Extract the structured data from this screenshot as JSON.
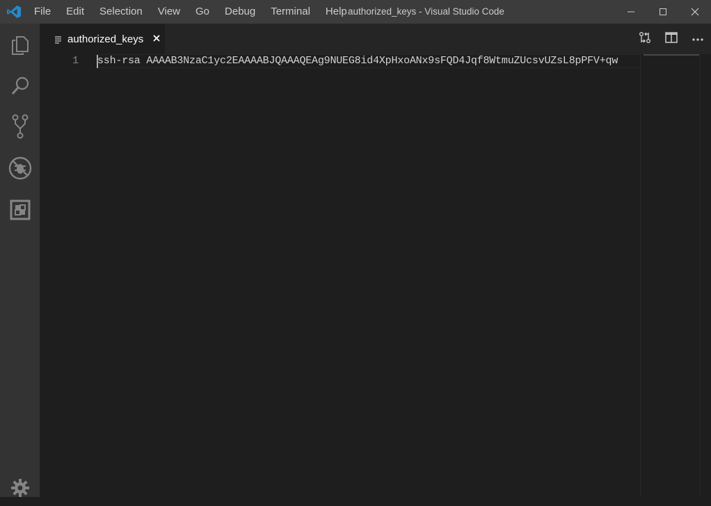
{
  "window": {
    "title": "authorized_keys - Visual Studio Code",
    "logo_icon": "vscode-logo-icon"
  },
  "menubar": {
    "items": [
      "File",
      "Edit",
      "Selection",
      "View",
      "Go",
      "Debug",
      "Terminal",
      "Help"
    ]
  },
  "window_controls": [
    "minimize-icon",
    "maximize-icon",
    "close-icon"
  ],
  "activitybar": {
    "icons": [
      "files-icon",
      "search-icon",
      "source-control-icon",
      "debug-icon",
      "extensions-icon",
      "gear-icon"
    ]
  },
  "tabs": [
    {
      "label": "authorized_keys",
      "icon": "file-lines-icon",
      "active": true
    }
  ],
  "editor_actions": [
    "open-changes-icon",
    "split-editor-icon",
    "more-actions-icon"
  ],
  "editor": {
    "lines": [
      {
        "number": "1",
        "text": "ssh-rsa AAAAB3NzaC1yc2EAAAABJQAAAQEAg9NUEG8id4XpHxoANx9sFQD4Jqf8WtmuZUcsvUZsL8pPFV+qw"
      }
    ]
  },
  "colors": {
    "titlebar": "#3c3c3c",
    "activitybar": "#333333",
    "editor_bg": "#1e1e1e",
    "tabbar_bg": "#252526",
    "text": "#d4d4d4",
    "line_number": "#858585",
    "logo_blue": "#2489ca"
  }
}
